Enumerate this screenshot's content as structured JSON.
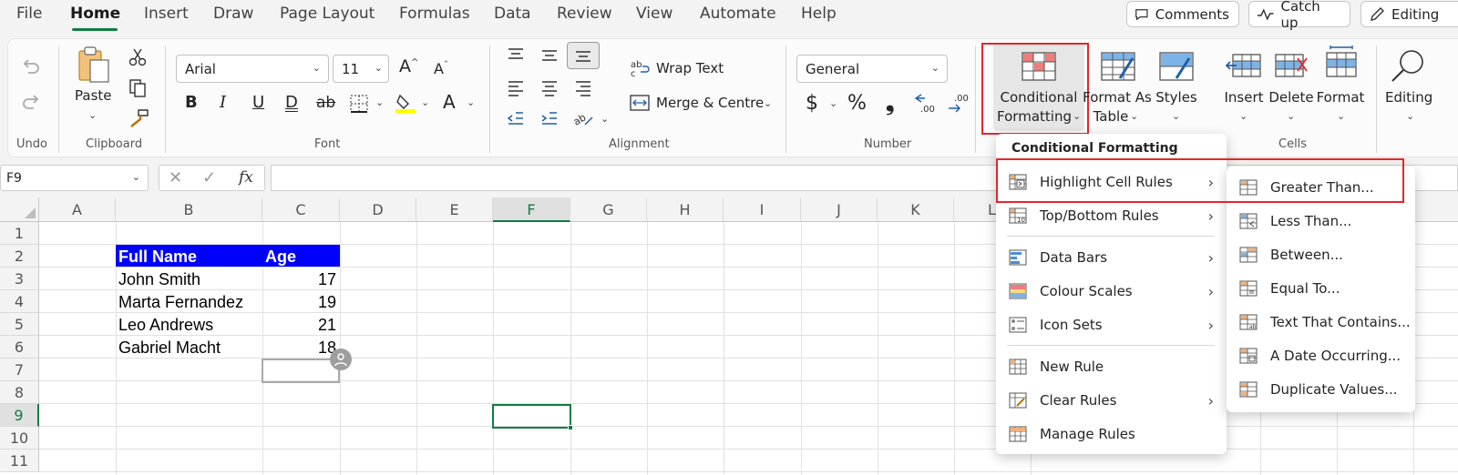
{
  "menubar": {
    "tabs": [
      "File",
      "Home",
      "Insert",
      "Draw",
      "Page Layout",
      "Formulas",
      "Data",
      "Review",
      "View",
      "Automate",
      "Help"
    ],
    "active_tab": "Home",
    "comments_label": "Comments",
    "catchup_label": "Catch up",
    "editing_label": "Editing"
  },
  "ribbon": {
    "undo_label": "Undo",
    "clipboard": {
      "paste_label": "Paste",
      "group_label": "Clipboard"
    },
    "font": {
      "name": "Arial",
      "size": "11",
      "group_label": "Font"
    },
    "alignment": {
      "wrap_label": "Wrap Text",
      "merge_label": "Merge & Centre",
      "group_label": "Alignment"
    },
    "number": {
      "format": "General",
      "currency": "$",
      "percent": "%",
      "comma": "❟",
      "group_label": "Number"
    },
    "styles": {
      "conditional_line1": "Conditional",
      "conditional_line2": "Formatting",
      "format_table_line1": "Format As",
      "format_table_line2": "Table",
      "styles_label": "Styles"
    },
    "cells": {
      "insert_label": "Insert",
      "delete_label": "Delete",
      "format_label": "Format",
      "group_label": "Cells"
    },
    "editing_label": "Editing"
  },
  "formula_bar": {
    "name_box": "F9",
    "fx": "fx",
    "value": ""
  },
  "grid": {
    "columns": [
      "A",
      "B",
      "C",
      "D",
      "E",
      "F",
      "G",
      "H",
      "I",
      "J",
      "K",
      "L"
    ],
    "rows": [
      "1",
      "2",
      "3",
      "4",
      "5",
      "6",
      "7",
      "8",
      "9",
      "10",
      "11"
    ],
    "selected_column": "F",
    "selected_row": "9",
    "table": {
      "headers": [
        "Full Name",
        "Age"
      ],
      "rows": [
        [
          "John Smith",
          "17"
        ],
        [
          "Marta Fernandez",
          "19"
        ],
        [
          "Leo Andrews",
          "21"
        ],
        [
          "Gabriel Macht",
          "18"
        ]
      ]
    }
  },
  "conditional_menu": {
    "title": "Conditional Formatting",
    "items": [
      "Highlight Cell Rules",
      "Top/Bottom Rules",
      "Data Bars",
      "Colour Scales",
      "Icon Sets",
      "New Rule",
      "Clear Rules",
      "Manage Rules"
    ]
  },
  "highlight_submenu": {
    "items": [
      "Greater Than...",
      "Less Than...",
      "Between...",
      "Equal To...",
      "Text That Contains...",
      "A Date Occurring...",
      "Duplicate Values..."
    ]
  },
  "colors": {
    "accent": "#107c41",
    "table_header_bg": "#0000ff",
    "highlight_red": "#e3262c"
  }
}
